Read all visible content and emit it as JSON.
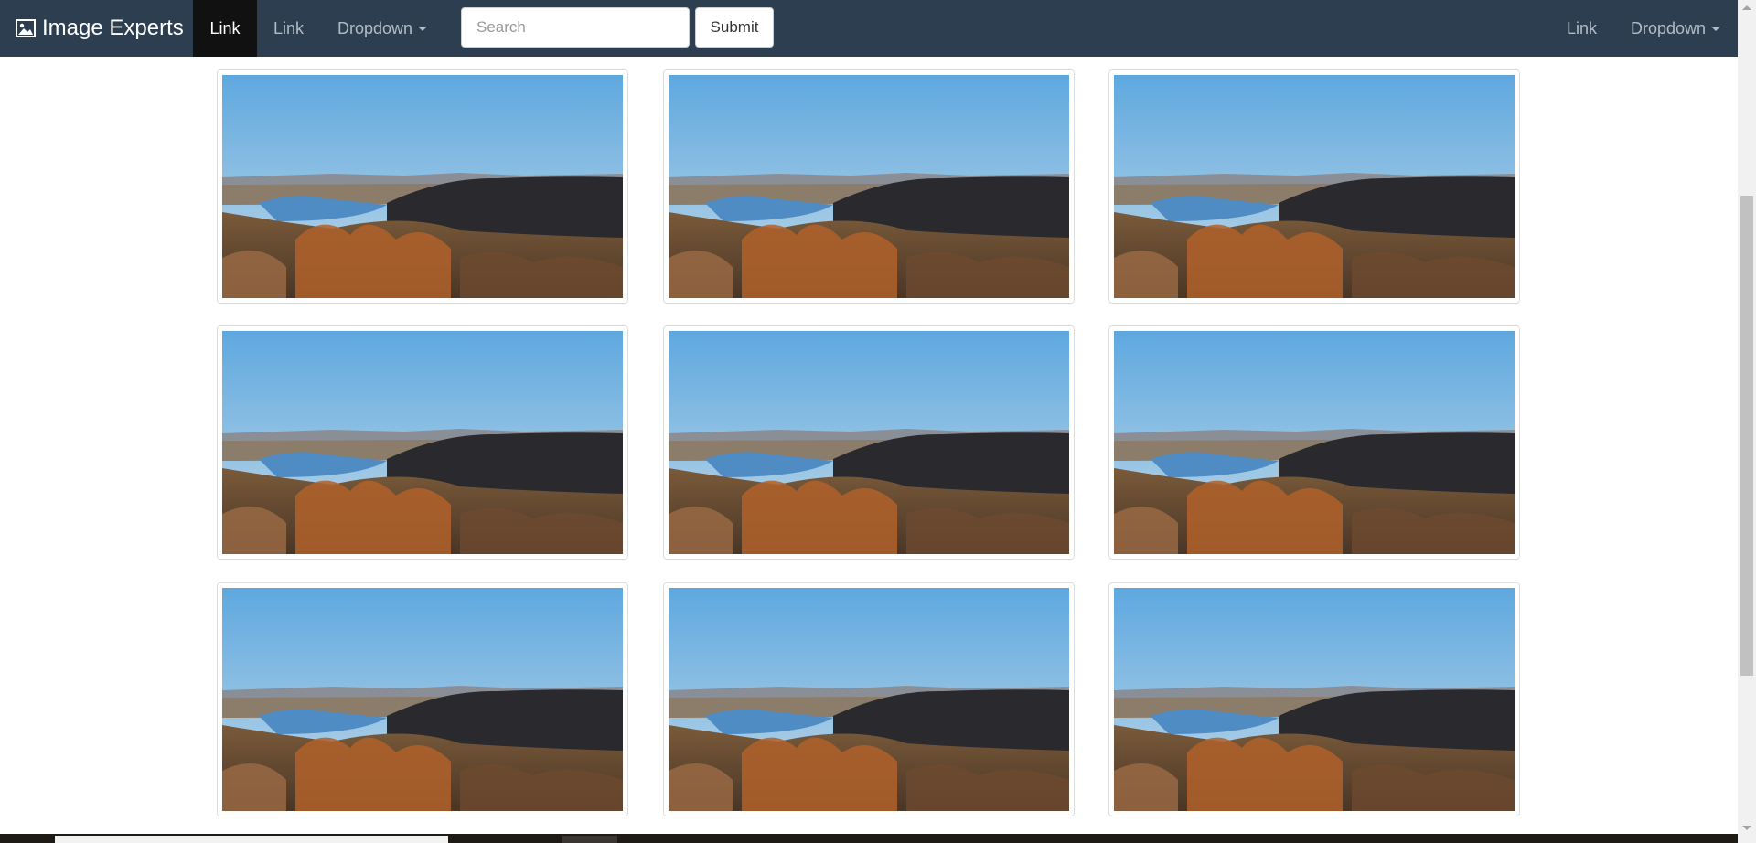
{
  "navbar": {
    "brand": "Image Experts",
    "brand_icon": "picture-icon",
    "left_links": [
      {
        "label": "Link",
        "active": true
      },
      {
        "label": "Link",
        "active": false
      },
      {
        "label": "Dropdown",
        "active": false
      }
    ],
    "search_placeholder": "Search",
    "search_value": "",
    "submit_label": "Submit",
    "right_links": [
      {
        "label": "Link"
      },
      {
        "label": "Dropdown"
      }
    ],
    "colors": {
      "background": "#2c3e50",
      "active": "#111111",
      "link": "#b2bcc6"
    }
  },
  "gallery": {
    "items": [
      {
        "picture": "landscape-photo"
      },
      {
        "picture": "landscape-photo"
      },
      {
        "picture": "landscape-photo"
      },
      {
        "picture": "landscape-photo"
      },
      {
        "picture": "landscape-photo"
      },
      {
        "picture": "landscape-photo"
      },
      {
        "picture": "landscape-photo"
      },
      {
        "picture": "landscape-photo"
      },
      {
        "picture": "landscape-photo"
      }
    ]
  }
}
